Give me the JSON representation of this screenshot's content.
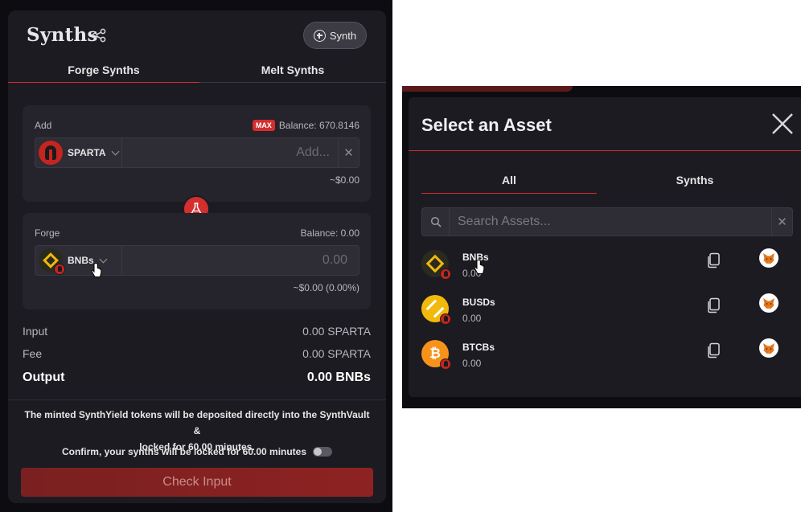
{
  "forge_panel": {
    "title": "Synths",
    "synth_button_label": "Synth",
    "tabs": [
      {
        "label": "Forge Synths",
        "active": true
      },
      {
        "label": "Melt Synths",
        "active": false
      }
    ],
    "add": {
      "label": "Add",
      "max_label": "MAX",
      "balance": "Balance: 670.8146",
      "token": "SPARTA",
      "placeholder": "Add...",
      "usd_value": "~$0.00"
    },
    "forge": {
      "label": "Forge",
      "balance": "Balance: 0.00",
      "token": "BNBs",
      "placeholder": "0.00",
      "usd_value": "~$0.00 (0.00%)"
    },
    "summary": {
      "input_label": "Input",
      "input_value": "0.00 SPARTA",
      "fee_label": "Fee",
      "fee_value": "0.00 SPARTA",
      "output_label": "Output",
      "output_value": "0.00 BNBs"
    },
    "notice_line1": "The minted SynthYield tokens will be deposited directly into the SynthVault &",
    "notice_line2": "locked for 60.00 minutes.",
    "confirm_label": "Confirm, your synths will be locked for 60.00 minutes",
    "check_button": "Check Input"
  },
  "asset_modal": {
    "title": "Select an Asset",
    "tabs": [
      {
        "label": "All",
        "active": true
      },
      {
        "label": "Synths",
        "active": false
      }
    ],
    "search_placeholder": "Search Assets...",
    "assets": [
      {
        "name": "BNBs",
        "balance": "0.00",
        "icon": "bnb-icon"
      },
      {
        "name": "BUSDs",
        "balance": "0.00",
        "icon": "busd-icon"
      },
      {
        "name": "BTCBs",
        "balance": "0.00",
        "icon": "btcb-icon"
      }
    ]
  },
  "colors": {
    "accent_red": "#d42e2e",
    "panel_bg": "#1d1b22",
    "box_bg": "#25232b",
    "page_bg": "#0d0c10"
  }
}
